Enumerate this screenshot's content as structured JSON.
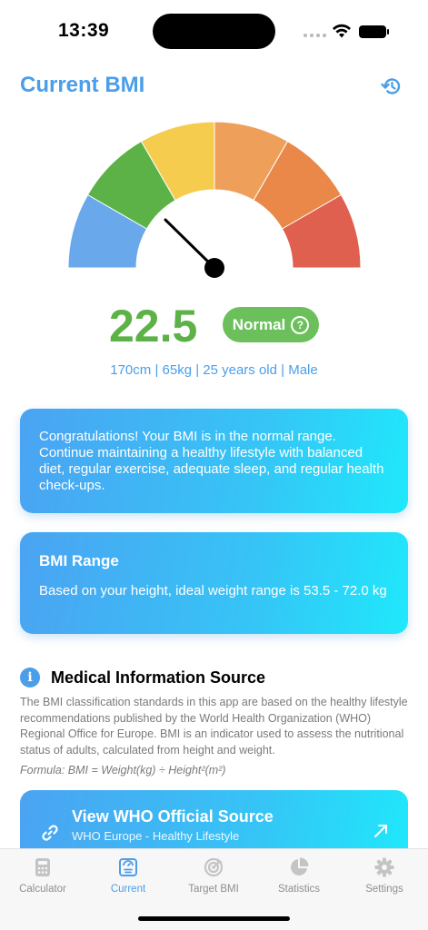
{
  "status_bar": {
    "time": "13:39"
  },
  "header": {
    "title": "Current BMI",
    "history_icon": "history-icon"
  },
  "gauge": {
    "colors": [
      "#6aa8ec",
      "#5cb246",
      "#f5cc4e",
      "#eea05a",
      "#e98848",
      "#e06050"
    ],
    "needle_value": 22.5
  },
  "result": {
    "bmi": "22.5",
    "status": "Normal",
    "status_color": "#6cc05c",
    "profile": "170cm | 65kg | 25 years old | Male"
  },
  "cards": {
    "congrats": "Congratulations! Your BMI is in the normal range. Continue maintaining a healthy lifestyle with balanced diet, regular exercise, adequate sleep, and regular health check-ups.",
    "range_title": "BMI Range",
    "range_text": "Based on your height, ideal weight range is 53.5 - 72.0 kg"
  },
  "medical": {
    "title": "Medical Information Source",
    "body": "The BMI classification standards in this app are based on the healthy lifestyle recommendations published by the World Health Organization (WHO) Regional Office for Europe. BMI is an indicator used to assess the nutritional status of adults, calculated from height and weight.",
    "formula": "Formula: BMI = Weight(kg) ÷ Height²(m²)"
  },
  "who_card": {
    "title": "View WHO Official Source",
    "subtitle": "WHO Europe - Healthy Lifestyle"
  },
  "tabs": [
    {
      "label": "Calculator",
      "icon": "calculator-icon",
      "active": false
    },
    {
      "label": "Current",
      "icon": "current-bmi-icon",
      "active": true
    },
    {
      "label": "Target BMI",
      "icon": "target-icon",
      "active": false
    },
    {
      "label": "Statistics",
      "icon": "pie-chart-icon",
      "active": false
    },
    {
      "label": "Settings",
      "icon": "gear-icon",
      "active": false
    }
  ],
  "colors": {
    "accent": "#4a9eea",
    "normal_green": "#5cb246",
    "tab_inactive": "#8e8e8e"
  }
}
